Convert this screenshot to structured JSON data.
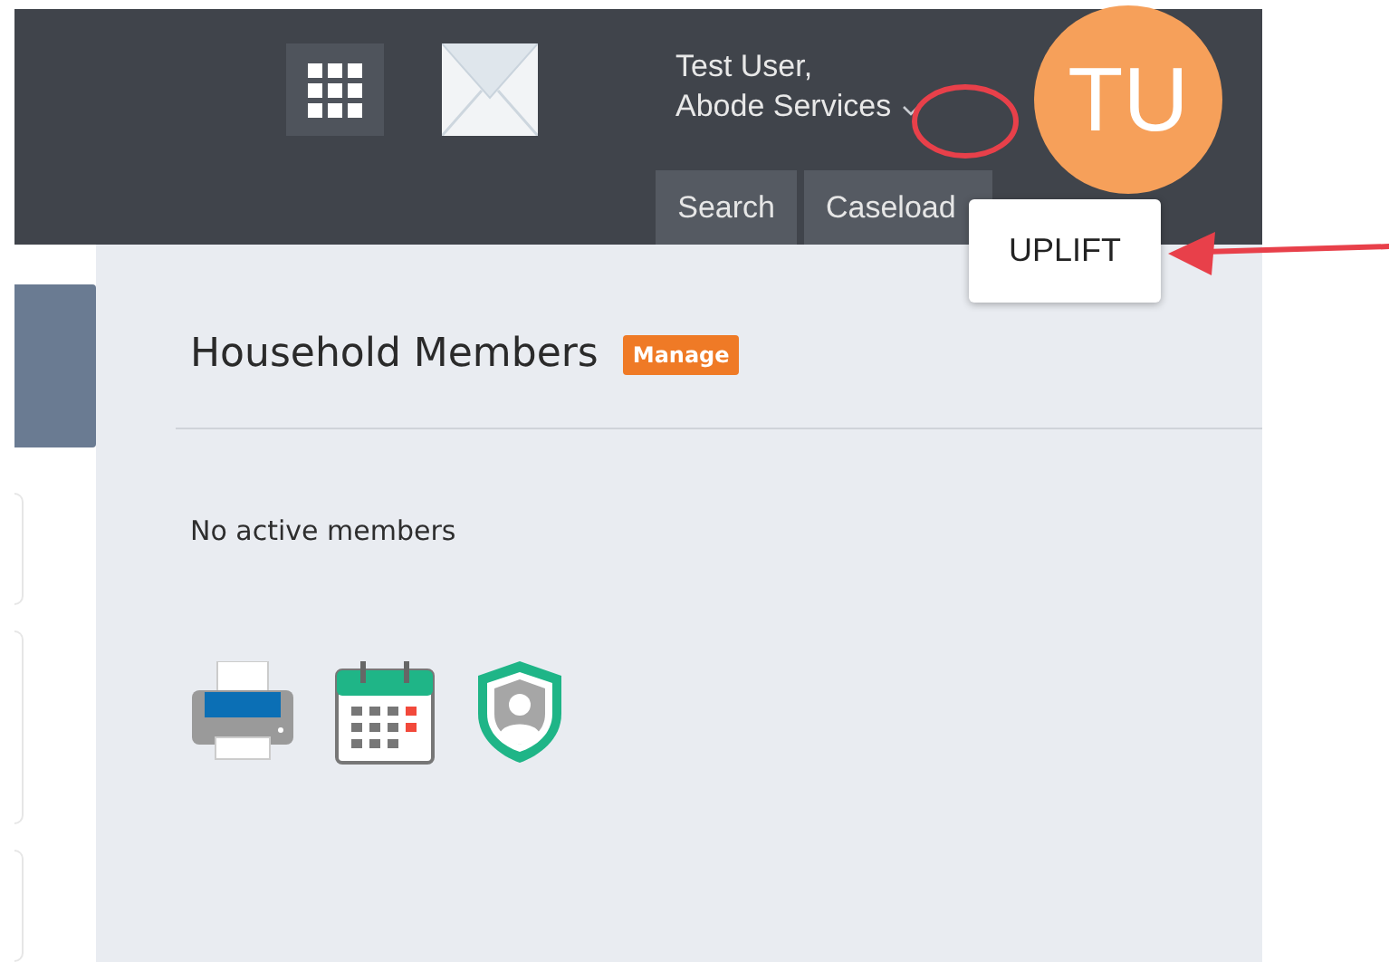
{
  "header": {
    "user_name": "Test User,",
    "organisation": "Abode Services",
    "avatar_initials": "TU",
    "nav_buttons": [
      {
        "label": "Search"
      },
      {
        "label": "Caseload"
      }
    ],
    "popup": {
      "label": "UPLIFT"
    }
  },
  "section": {
    "title": "Household Members",
    "badge": "Manage",
    "empty_text": "No active members"
  }
}
